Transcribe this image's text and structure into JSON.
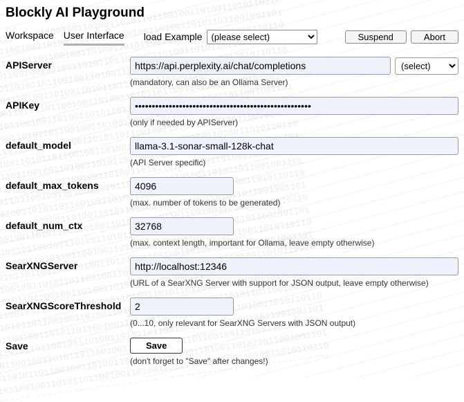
{
  "header": {
    "title": "Blockly AI Playground"
  },
  "tabs": {
    "workspace": "Workspace",
    "user_interface": "User Interface"
  },
  "load_example": {
    "label": "load Example",
    "selected": "(please select)"
  },
  "buttons": {
    "suspend": "Suspend",
    "abort": "Abort"
  },
  "fields": {
    "api_server": {
      "label": "APIServer",
      "value": "https://api.perplexity.ai/chat/completions",
      "select": "(select)",
      "hint": "(mandatory, can also be an Ollama Server)"
    },
    "api_key": {
      "label": "APIKey",
      "value": "••••••••••••••••••••••••••••••••••••••••••••••••••••",
      "hint": "(only if needed by APIServer)"
    },
    "default_model": {
      "label": "default_model",
      "value": "llama-3.1-sonar-small-128k-chat",
      "hint": "(API Server specific)"
    },
    "default_max_tokens": {
      "label": "default_max_tokens",
      "value": "4096",
      "hint": "(max. number of tokens to be generated)"
    },
    "default_num_ctx": {
      "label": "default_num_ctx",
      "value": "32768",
      "hint": "(max. context length, important for Ollama, leave empty otherwise)"
    },
    "searxng_server": {
      "label": "SearXNGServer",
      "value": "http://localhost:12346",
      "hint": "(URL of a SearXNG Server with support for JSON output, leave empty otherwise)"
    },
    "searxng_score_threshold": {
      "label": "SearXNGScoreThreshold",
      "value": "2",
      "hint": "(0...10, only relevant for SearXNG Servers with JSON output)"
    },
    "save": {
      "label": "Save",
      "button": "Save",
      "hint": "(don't forget to \"Save\" after changes!)"
    }
  }
}
